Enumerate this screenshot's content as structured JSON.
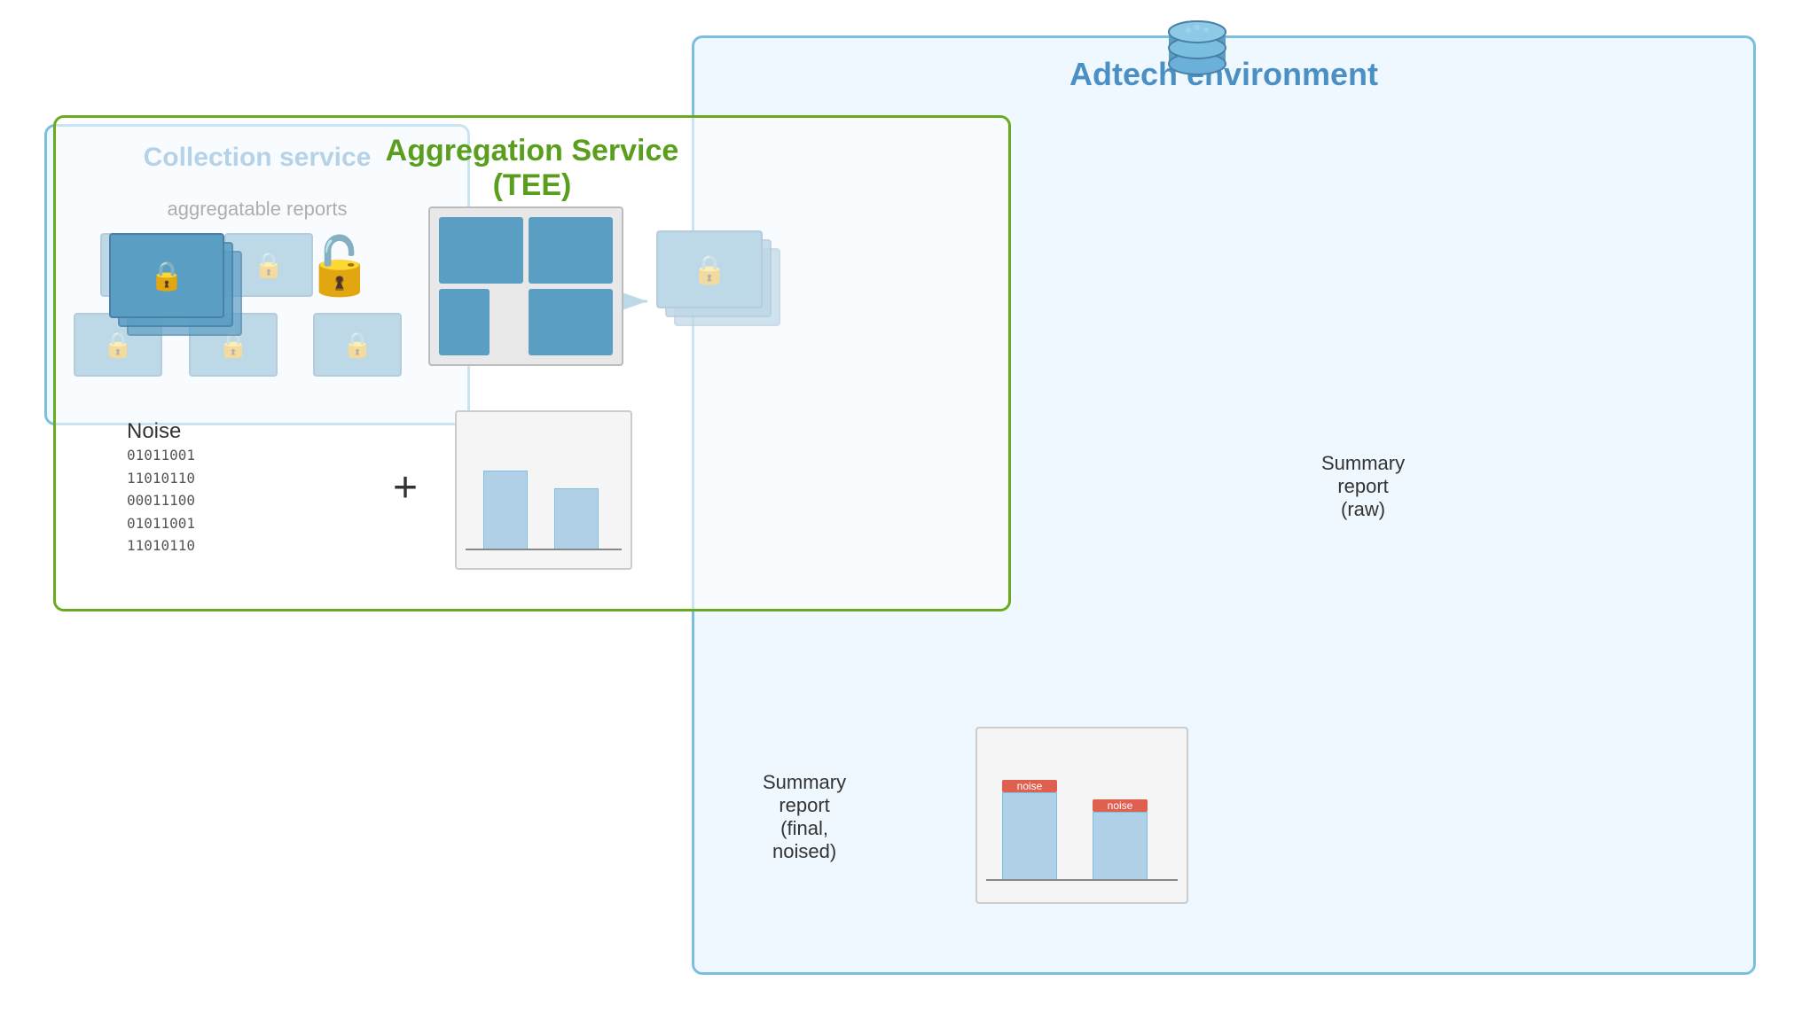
{
  "diagram": {
    "adtech_label": "Adtech environment",
    "collection_service_label": "Collection service",
    "aggregatable_text": "aggregatable reports",
    "aggregation_service_label": "Aggregation Service",
    "aggregation_service_sublabel": "(TEE)",
    "noise_label": "Noise",
    "noise_binary": [
      "01011001",
      "11010110",
      "00011100",
      "01011001",
      "11010110"
    ],
    "summary_report_raw_label": "Summary report",
    "summary_report_raw_sublabel": "(raw)",
    "summary_report_final_label": "Summary report",
    "summary_report_final_sublabel": "(final, noised)",
    "noise_tag_1": "noise",
    "noise_tag_2": "noise"
  }
}
